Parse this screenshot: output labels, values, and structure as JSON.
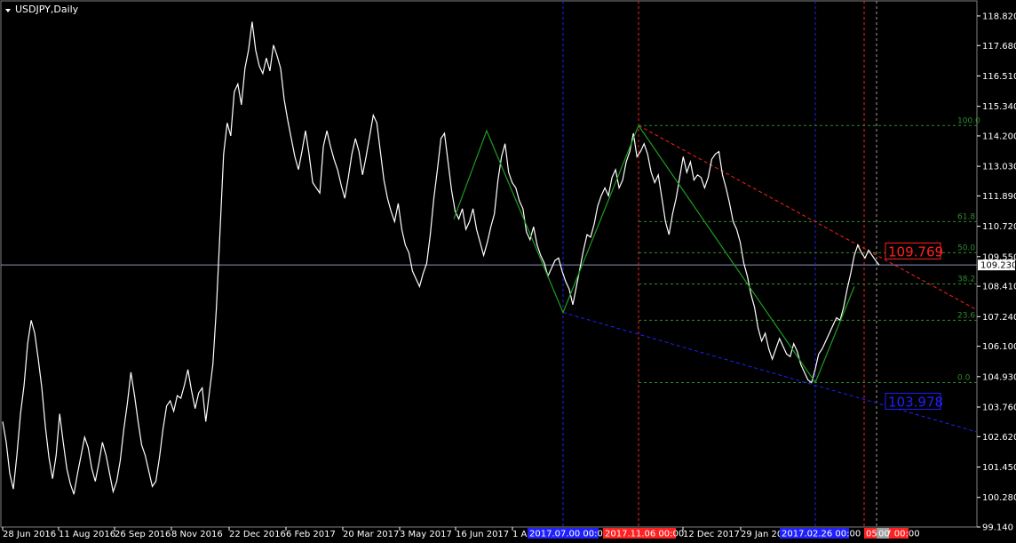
{
  "chart_data": {
    "type": "line",
    "title": "USDJPY,Daily",
    "symbol": "USDJPY",
    "timeframe": "Daily",
    "ylim": [
      99.14,
      119.4
    ],
    "y_ticks": [
      99.14,
      100.28,
      101.45,
      102.62,
      103.76,
      104.93,
      106.1,
      107.24,
      108.41,
      109.55,
      110.72,
      111.89,
      113.03,
      114.2,
      115.34,
      116.51,
      117.68,
      118.82
    ],
    "y_tick_labels": [
      "99.140",
      "100.280",
      "101.450",
      "102.620",
      "103.760",
      "104.930",
      "106.100",
      "107.240",
      "108.410",
      "109.550",
      "110.720",
      "111.890",
      "113.030",
      "114.200",
      "115.340",
      "116.510",
      "117.680",
      "118.820"
    ],
    "x_tick_labels": [
      "28 Jun 2016",
      "11 Aug 2016",
      "26 Sep 2016",
      "8 Nov 2016",
      "22 Dec 2016",
      "6 Feb 2017",
      "20 Mar 2017",
      "3 May 2017",
      "16 Jun 2017",
      "1 Au",
      "12 Dec 2017",
      "29 Jan 201"
    ],
    "current_price": 109.23,
    "current_price_label": "109.230",
    "series": [
      {
        "values": [
          103.2,
          102.4,
          101.2,
          100.6,
          101.9,
          103.5,
          104.6,
          106.2,
          107.1,
          106.6,
          105.6,
          104.5,
          103.0,
          101.8,
          101.0,
          101.9,
          103.5,
          102.4,
          101.4,
          100.8,
          100.4,
          101.2,
          101.9,
          102.6,
          102.2,
          101.4,
          100.9,
          101.6,
          102.4,
          101.9,
          101.2,
          100.5,
          100.9,
          101.7,
          102.9,
          103.9,
          105.1,
          104.2,
          103.2,
          102.3,
          101.9,
          101.3,
          100.7,
          100.9,
          101.8,
          102.9,
          103.8,
          104.0,
          103.6,
          104.2,
          104.1,
          104.6,
          105.2,
          104.4,
          103.7,
          104.3,
          104.5,
          103.2,
          104.3,
          105.4,
          107.6,
          110.5,
          113.5,
          114.7,
          114.2,
          115.9,
          116.2,
          115.4,
          116.8,
          117.5,
          118.6,
          117.5,
          116.9,
          116.6,
          117.2,
          116.7,
          117.7,
          117.3,
          116.8,
          115.6,
          114.8,
          114.1,
          113.4,
          112.9,
          113.6,
          114.4,
          113.5,
          112.4,
          112.2,
          112.0,
          113.8,
          114.4,
          113.8,
          113.3,
          112.9,
          112.3,
          111.8,
          112.6,
          113.5,
          114.1,
          113.6,
          112.7,
          113.4,
          114.2,
          115.0,
          114.7,
          113.6,
          112.5,
          111.8,
          111.3,
          110.9,
          111.6,
          110.6,
          110.0,
          109.7,
          109.0,
          108.7,
          108.4,
          108.9,
          109.3,
          110.4,
          111.8,
          112.9,
          114.1,
          114.3,
          113.2,
          112.1,
          111.3,
          111.0,
          111.4,
          110.6,
          110.9,
          111.4,
          110.6,
          110.1,
          109.6,
          110.1,
          110.7,
          111.2,
          112.5,
          113.4,
          113.9,
          112.8,
          112.4,
          112.2,
          111.7,
          111.4,
          110.5,
          110.2,
          110.7,
          110.0,
          109.6,
          109.3,
          108.8,
          109.1,
          109.4,
          109.5,
          109.0,
          108.6,
          108.3,
          107.7,
          108.4,
          109.1,
          109.8,
          110.4,
          110.3,
          110.8,
          111.5,
          111.9,
          112.2,
          111.9,
          112.6,
          112.9,
          112.2,
          112.5,
          113.2,
          113.6,
          114.3,
          113.4,
          113.6,
          113.9,
          113.5,
          112.8,
          112.4,
          112.7,
          111.8,
          110.9,
          110.4,
          111.2,
          111.8,
          112.6,
          113.4,
          112.8,
          113.2,
          112.5,
          112.7,
          112.6,
          112.2,
          112.6,
          113.3,
          113.5,
          113.6,
          112.7,
          112.2,
          111.6,
          110.9,
          110.6,
          110.1,
          109.3,
          108.8,
          108.1,
          107.6,
          106.8,
          106.3,
          106.6,
          106.0,
          105.6,
          106.0,
          106.4,
          106.1,
          105.8,
          105.7,
          106.2,
          105.9,
          105.4,
          105.1,
          104.8,
          104.7,
          105.2,
          105.8,
          106.0,
          106.3,
          106.6,
          106.9,
          107.2,
          107.1,
          107.6,
          108.3,
          108.9,
          109.6,
          110.0,
          109.7,
          109.5,
          109.8,
          109.6,
          109.4,
          109.23
        ]
      }
    ],
    "zigzag": [
      111.0,
      114.4,
      107.4,
      114.6,
      104.7,
      108.4
    ],
    "fib_levels": [
      {
        "label": "100.0",
        "price": 114.6
      },
      {
        "label": "61.8",
        "price": 110.9
      },
      {
        "label": "50.0",
        "price": 109.7
      },
      {
        "label": "38.2",
        "price": 108.5
      },
      {
        "label": "23.6",
        "price": 107.1
      },
      {
        "label": "0.0",
        "price": 104.7
      }
    ],
    "upper_trend_label": "109.769",
    "lower_trend_label": "103.978",
    "vertical_markers": [
      {
        "label": "2017.07.00 00:00",
        "color": "#2020ff"
      },
      {
        "label": "2017.11.06 00:00",
        "color": "#ff2020"
      },
      {
        "label": "2017.02.26 00:00",
        "color": "#2020ff"
      },
      {
        "label": "05.07 00:00",
        "color": "#ff2020"
      },
      {
        "label": "00",
        "color": "#a0a0a0"
      }
    ],
    "grid": false,
    "colors": {
      "background": "#000000",
      "price_line": "#ffffff",
      "zigzag": "#1e9e1e",
      "fib": "#2e8b2e",
      "upper_trend": "#ff2020",
      "lower_trend": "#2020ff",
      "current_price_line": "#9090c0"
    }
  }
}
